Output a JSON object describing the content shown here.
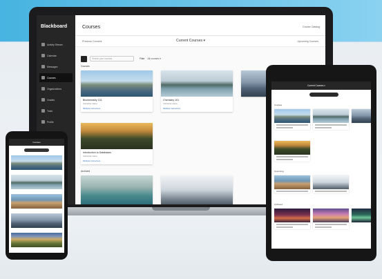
{
  "laptop": {
    "brand": "Blackboard",
    "page_title": "Courses",
    "top_link": "Course Catalog",
    "prev_term": "Previous Courses",
    "current_term": "Current Courses ▾",
    "next_term": "Upcoming Courses",
    "search_placeholder": "Search your courses",
    "filter_label": "Filter",
    "filter_value": "All courses ▾",
    "section_label": "Courses",
    "section_label_2": "Archived",
    "nav_items": [
      "Activity Stream",
      "Calendar",
      "Messages",
      "Courses",
      "Organizations",
      "Grades",
      "Tools",
      "Profile"
    ],
    "cards": [
      {
        "title": "Biochemistry 101",
        "sub": "Instructor name",
        "link": "Multiple Instructors"
      },
      {
        "title": "Chemistry 101",
        "sub": "Instructor name",
        "link": "Multiple Instructors"
      },
      {
        "title": "Introduction to Databases",
        "sub": "Instructor name",
        "link": "Multiple Instructors"
      }
    ]
  },
  "phone": {
    "title": "Courses"
  },
  "tablet": {
    "title": "Current Courses ▾",
    "section_1": "Courses",
    "section_2": "Upcoming",
    "section_3": "Archived"
  },
  "colors": {
    "sky": "#56bde6",
    "sidebar": "#262626",
    "link": "#2a6ebb"
  }
}
